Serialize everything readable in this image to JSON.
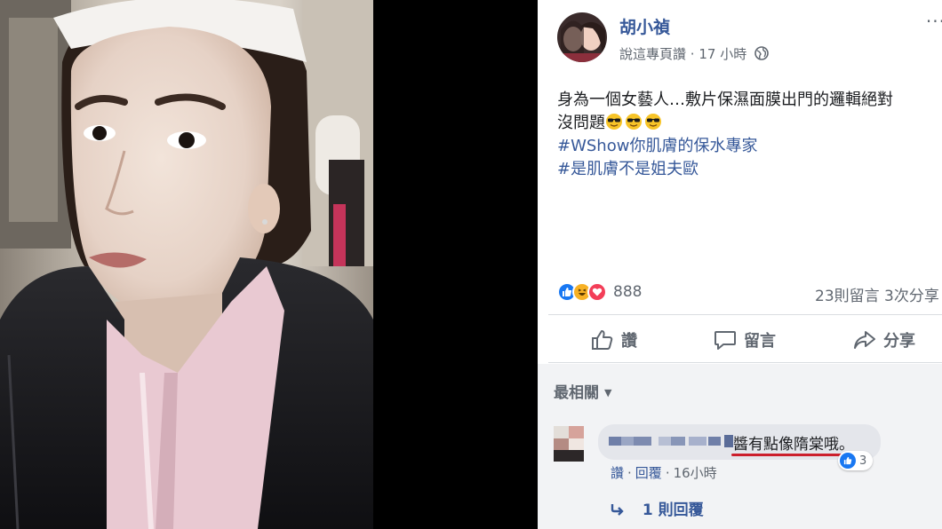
{
  "post": {
    "author": "胡小禎",
    "meta": {
      "like_label": "說這專頁讚",
      "separator": "·",
      "time": "17 小時",
      "privacy_icon": "globe-icon"
    },
    "more_icon": "more-dots-icon",
    "more_label": "···",
    "text": {
      "line1": "身為一個女藝人…敷片保濕面膜出門的邏輯絕對",
      "line2": "沒問題",
      "line2_emoji": [
        "sunglasses-emoji",
        "sunglasses-emoji",
        "sunglasses-emoji"
      ],
      "hashtag1": "#WShow你肌膚的保水專家",
      "hashtag2": "#是肌膚不是姐夫歐"
    },
    "reactions": {
      "types": [
        "like",
        "haha",
        "love"
      ],
      "count": "888"
    },
    "counts": {
      "comments": "23則留言",
      "shares": "3次分享"
    },
    "actions": {
      "like": "讚",
      "comment": "留言",
      "share": "分享"
    }
  },
  "comments": {
    "sort_label": "最相關",
    "items": [
      {
        "text": "醬有點像隋棠哦。",
        "reaction_count": "3",
        "like_label": "讚",
        "reply_label": "回覆",
        "separator": "·",
        "time": "16小時",
        "replies_label": "1 則回覆"
      }
    ]
  },
  "colors": {
    "link": "#365899",
    "secondary": "#606770",
    "like_blue": "#1877f2",
    "love_red": "#f33e58",
    "haha_yellow": "#f7b125",
    "highlight_red": "#cc1f2c"
  }
}
